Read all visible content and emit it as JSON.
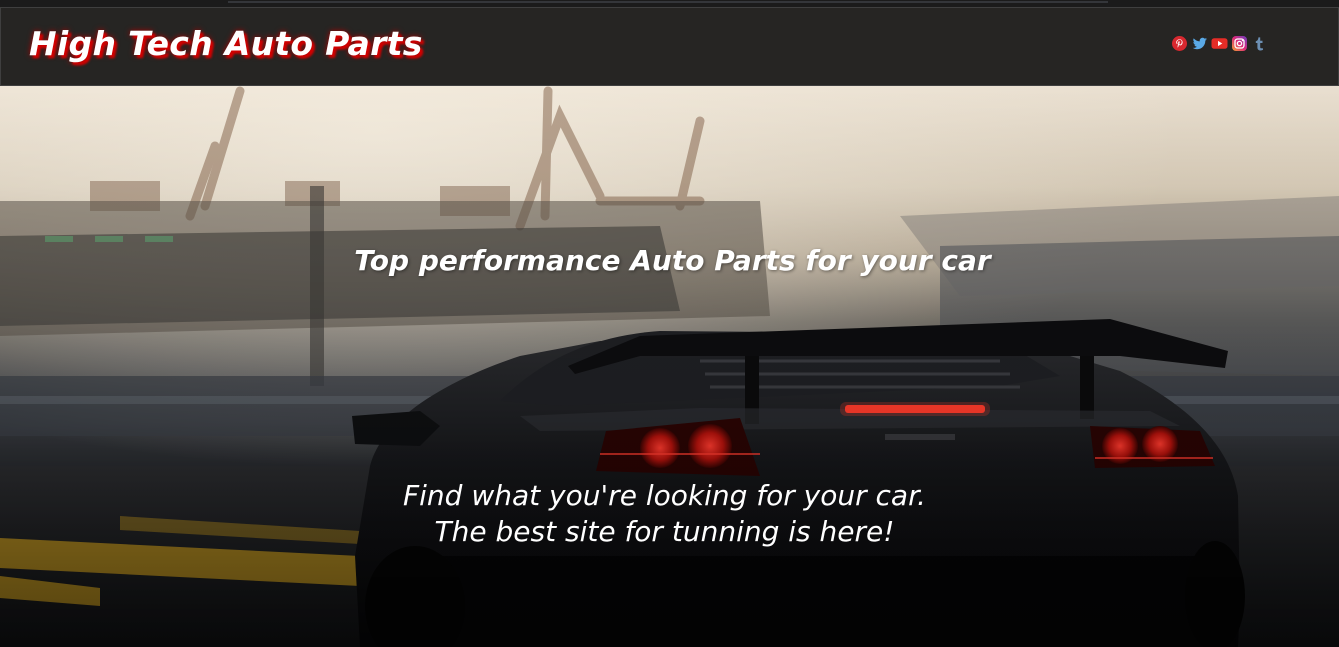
{
  "header": {
    "brand": "High Tech Auto Parts",
    "social_icons": [
      {
        "name": "pinterest-icon",
        "color": "#e60023"
      },
      {
        "name": "twitter-icon",
        "color": "#1da1f2"
      },
      {
        "name": "youtube-icon",
        "color": "#ff0000"
      },
      {
        "name": "instagram-icon",
        "color": "#c13584"
      },
      {
        "name": "tumblr-icon",
        "color": "#6c8fb3"
      }
    ]
  },
  "hero": {
    "tagline": "Top performance Auto Parts for your car",
    "subtext_line1": "Find what you're looking for your car.",
    "subtext_line2": "The best site for tunning is here!",
    "background_image": "sports-car-rear-at-harbor-photo"
  },
  "colors": {
    "header_bg": "#262523",
    "brand_shadow": "#d10000",
    "text": "#ffffff"
  }
}
